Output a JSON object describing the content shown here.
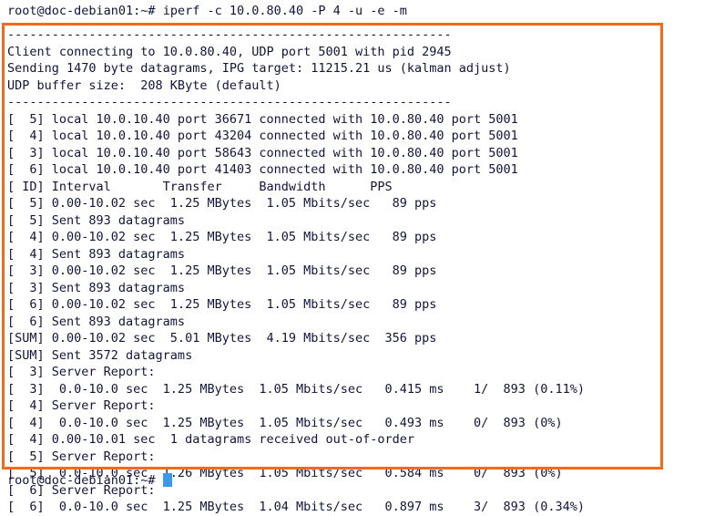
{
  "terminal": {
    "prompt": "root@doc-debian01:~# ",
    "command": "iperf -c 10.0.80.40 -P 4 -u -e -m",
    "prompt_bottom": "root@doc-debian01:~# ",
    "cursor": "block-cursor",
    "colors": {
      "background": "#ffffff",
      "text": "#12143c",
      "highlight_border": "#f26a1b",
      "cursor": "#3b97f0"
    },
    "output_lines": [
      "------------------------------------------------------------",
      "Client connecting to 10.0.80.40, UDP port 5001 with pid 2945",
      "Sending 1470 byte datagrams, IPG target: 11215.21 us (kalman adjust)",
      "UDP buffer size:  208 KByte (default)",
      "------------------------------------------------------------",
      "[  5] local 10.0.10.40 port 36671 connected with 10.0.80.40 port 5001",
      "[  4] local 10.0.10.40 port 43204 connected with 10.0.80.40 port 5001",
      "[  3] local 10.0.10.40 port 58643 connected with 10.0.80.40 port 5001",
      "[  6] local 10.0.10.40 port 41403 connected with 10.0.80.40 port 5001",
      "[ ID] Interval       Transfer     Bandwidth      PPS",
      "[  5] 0.00-10.02 sec  1.25 MBytes  1.05 Mbits/sec   89 pps",
      "[  5] Sent 893 datagrams",
      "[  4] 0.00-10.02 sec  1.25 MBytes  1.05 Mbits/sec   89 pps",
      "[  4] Sent 893 datagrams",
      "[  3] 0.00-10.02 sec  1.25 MBytes  1.05 Mbits/sec   89 pps",
      "[  3] Sent 893 datagrams",
      "[  6] 0.00-10.02 sec  1.25 MBytes  1.05 Mbits/sec   89 pps",
      "[  6] Sent 893 datagrams",
      "[SUM] 0.00-10.02 sec  5.01 MBytes  4.19 Mbits/sec  356 pps",
      "[SUM] Sent 3572 datagrams",
      "[  3] Server Report:",
      "[  3]  0.0-10.0 sec  1.25 MBytes  1.05 Mbits/sec   0.415 ms    1/  893 (0.11%)",
      "[  4] Server Report:",
      "[  4]  0.0-10.0 sec  1.25 MBytes  1.05 Mbits/sec   0.493 ms    0/  893 (0%)",
      "[  4] 0.00-10.01 sec  1 datagrams received out-of-order",
      "[  5] Server Report:",
      "[  5]  0.0-10.0 sec  1.26 MBytes  1.05 Mbits/sec   0.584 ms    0/  893 (0%)",
      "[  6] Server Report:",
      "[  6]  0.0-10.0 sec  1.25 MBytes  1.04 Mbits/sec   0.897 ms    3/  893 (0.34%)"
    ]
  }
}
